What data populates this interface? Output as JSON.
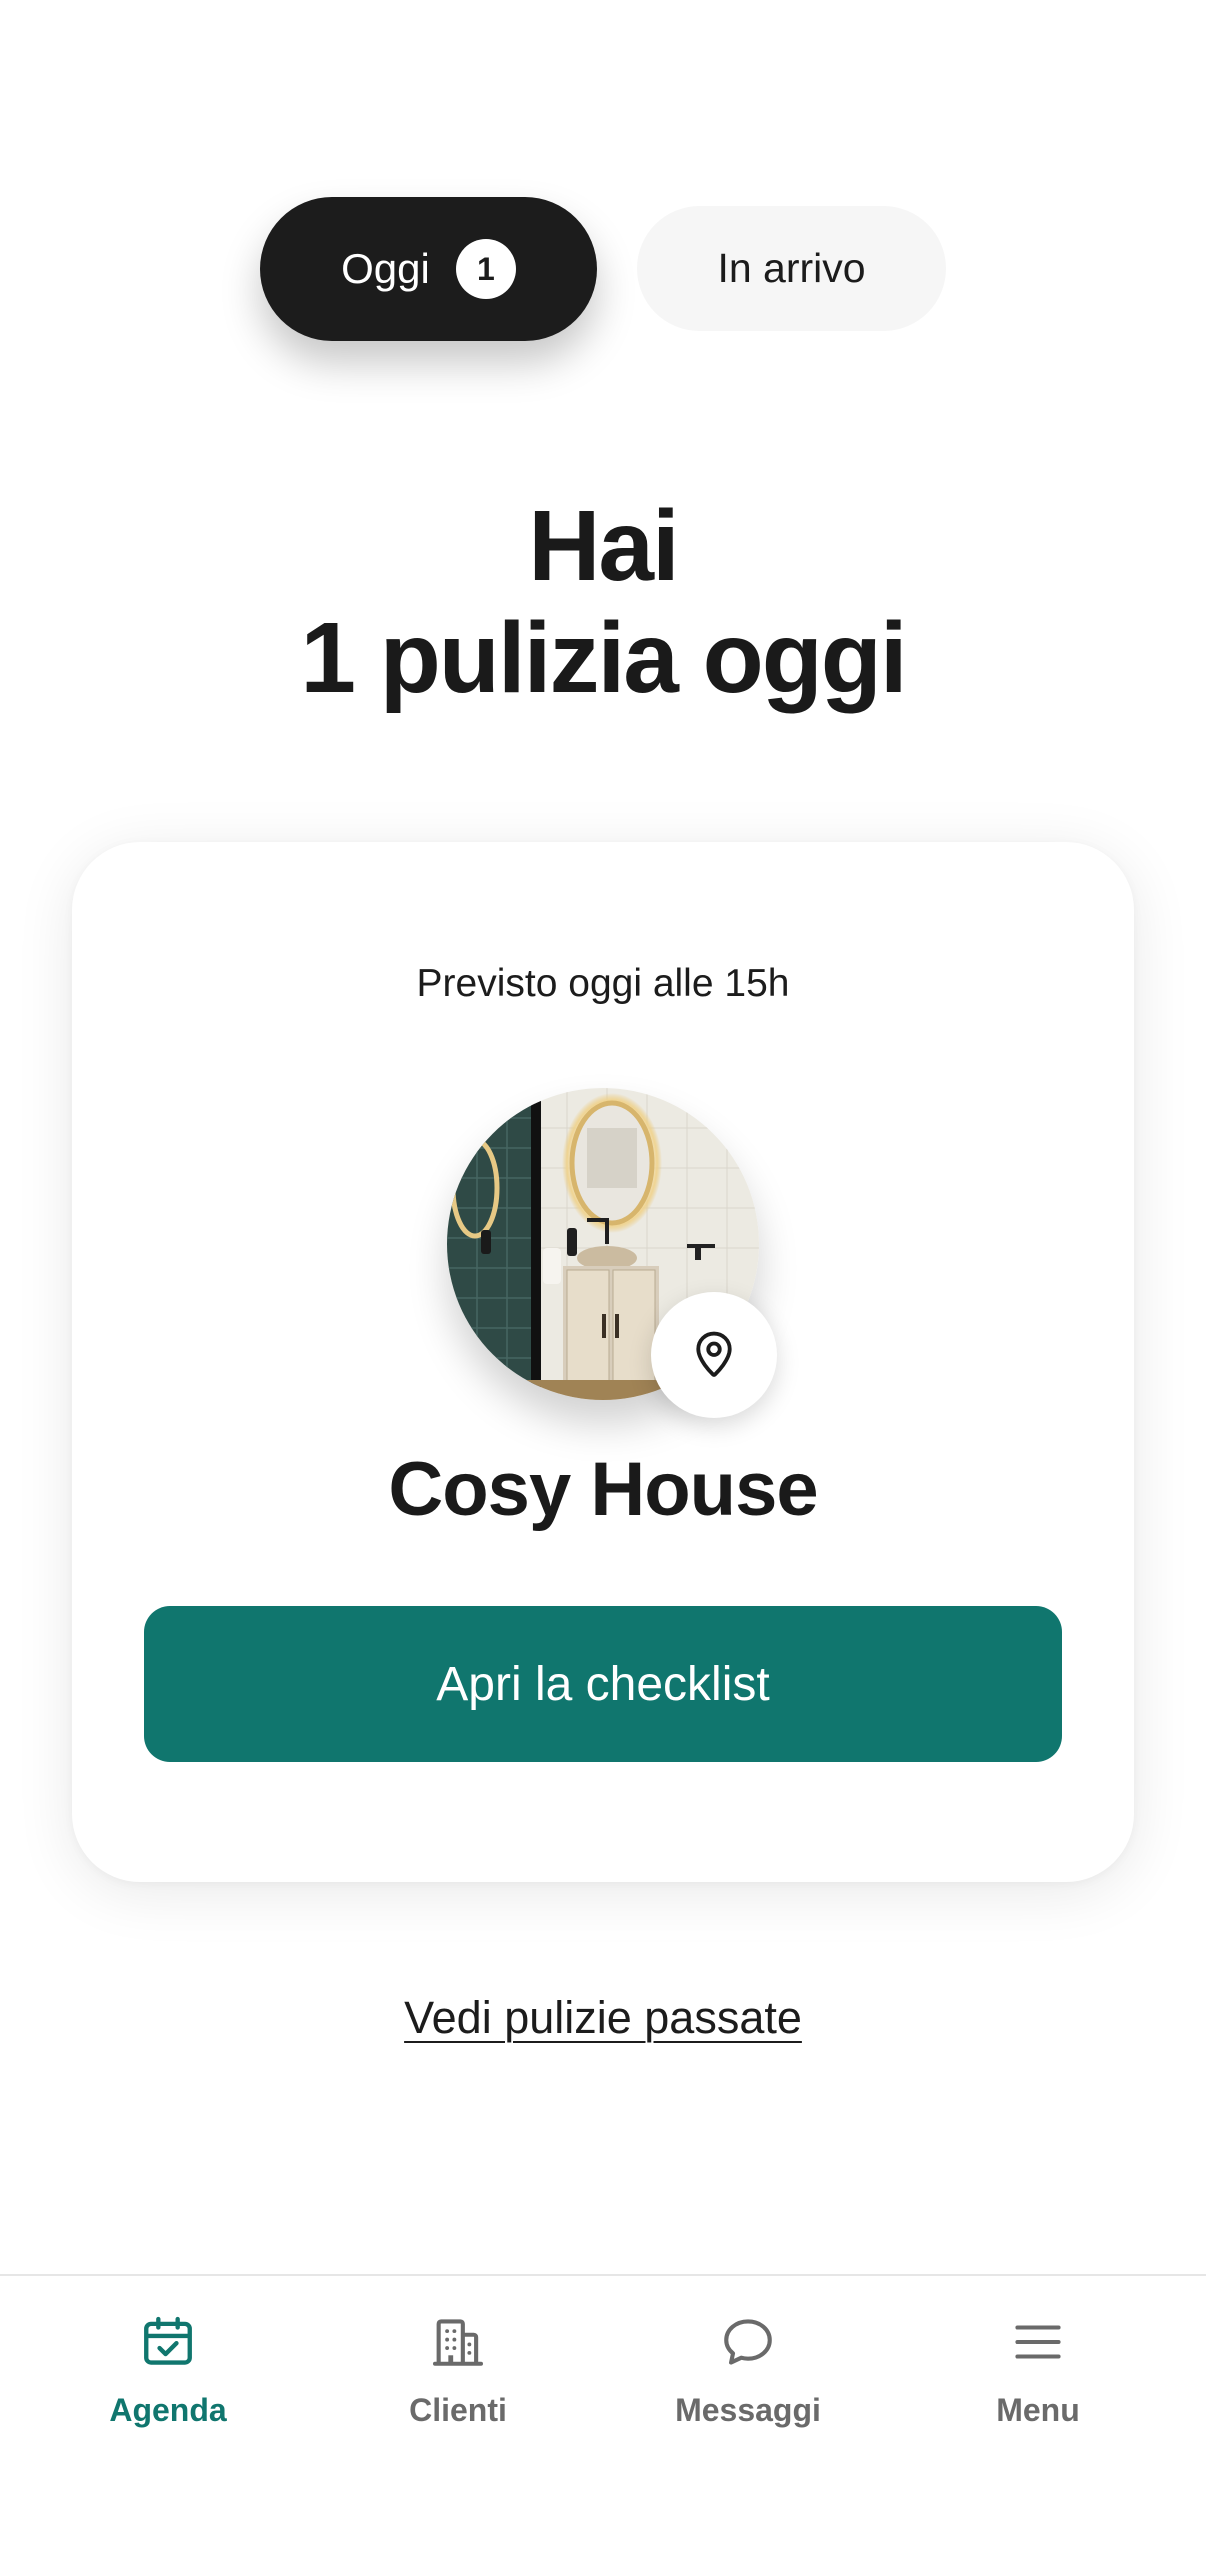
{
  "tabs": {
    "today": {
      "label": "Oggi",
      "badge": "1"
    },
    "upcoming": {
      "label": "In arrivo"
    },
    "selected": "today"
  },
  "heading": {
    "line1": "Hai",
    "line2": "1 pulizia oggi"
  },
  "card": {
    "scheduled": "Previsto oggi alle 15h",
    "property_name": "Cosy House",
    "photo_icon": "bathroom-photo",
    "location_icon": "map-pin-icon",
    "cta_label": "Apri la checklist"
  },
  "past_link": "Vedi pulizie passate",
  "bottom_nav": {
    "items": [
      {
        "label": "Agenda",
        "icon": "calendar-check-icon",
        "active": true
      },
      {
        "label": "Clienti",
        "icon": "building-icon",
        "active": false
      },
      {
        "label": "Messaggi",
        "icon": "chat-bubble-icon",
        "active": false
      },
      {
        "label": "Menu",
        "icon": "hamburger-menu-icon",
        "active": false
      }
    ]
  },
  "colors": {
    "accent": "#10766e",
    "dark": "#1c1c1c",
    "muted": "#6a6a6a"
  }
}
